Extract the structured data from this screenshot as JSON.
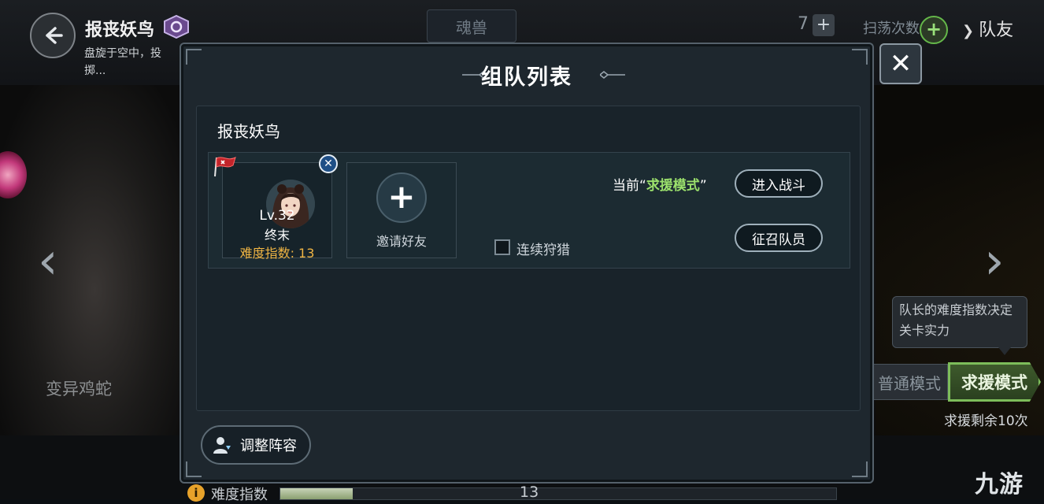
{
  "header": {
    "monster_name": "报丧妖鸟",
    "description": "盘旋于空中，投掷...\n人。而其尖锐的喙...",
    "tab_label": "魂兽",
    "count_value": "7",
    "sweep_label": "扫荡次数",
    "teammate_tab": "队友"
  },
  "background": {
    "left_monster_name": "变异鸡蛇"
  },
  "sidebar_right": {
    "tooltip": "队长的难度指数决定\n关卡实力",
    "mode_normal": "普通模式",
    "mode_rescue": "求援模式",
    "rescue_remaining": "求援剩余10次"
  },
  "footer": {
    "difficulty_label": "难度指数",
    "difficulty_value": "13",
    "difficulty_fill_fraction": 0.13,
    "watermark": "九游"
  },
  "modal": {
    "title": "组队列表",
    "boss_name": "报丧妖鸟",
    "member": {
      "level": "Lv.32",
      "name": "终末",
      "difficulty": "难度指数: 13"
    },
    "invite_label": "邀请好友",
    "auto_hunt_label": "连续狩猎",
    "mode_prefix": "当前",
    "mode_name": "求援模式",
    "enter_battle": "进入战斗",
    "recruit": "征召队员",
    "adjust_lineup": "调整阵容"
  },
  "icons": {
    "back": "back-arrow-icon",
    "close": "close-icon",
    "kick": "close-circle-icon",
    "leader": "leader-flag-icon",
    "invite": "plus-icon",
    "lineup": "person-icon"
  },
  "colors": {
    "accent_green": "#9be06c",
    "difficulty_orange": "#f0b544",
    "rescue_border": "#7dbd5a"
  }
}
